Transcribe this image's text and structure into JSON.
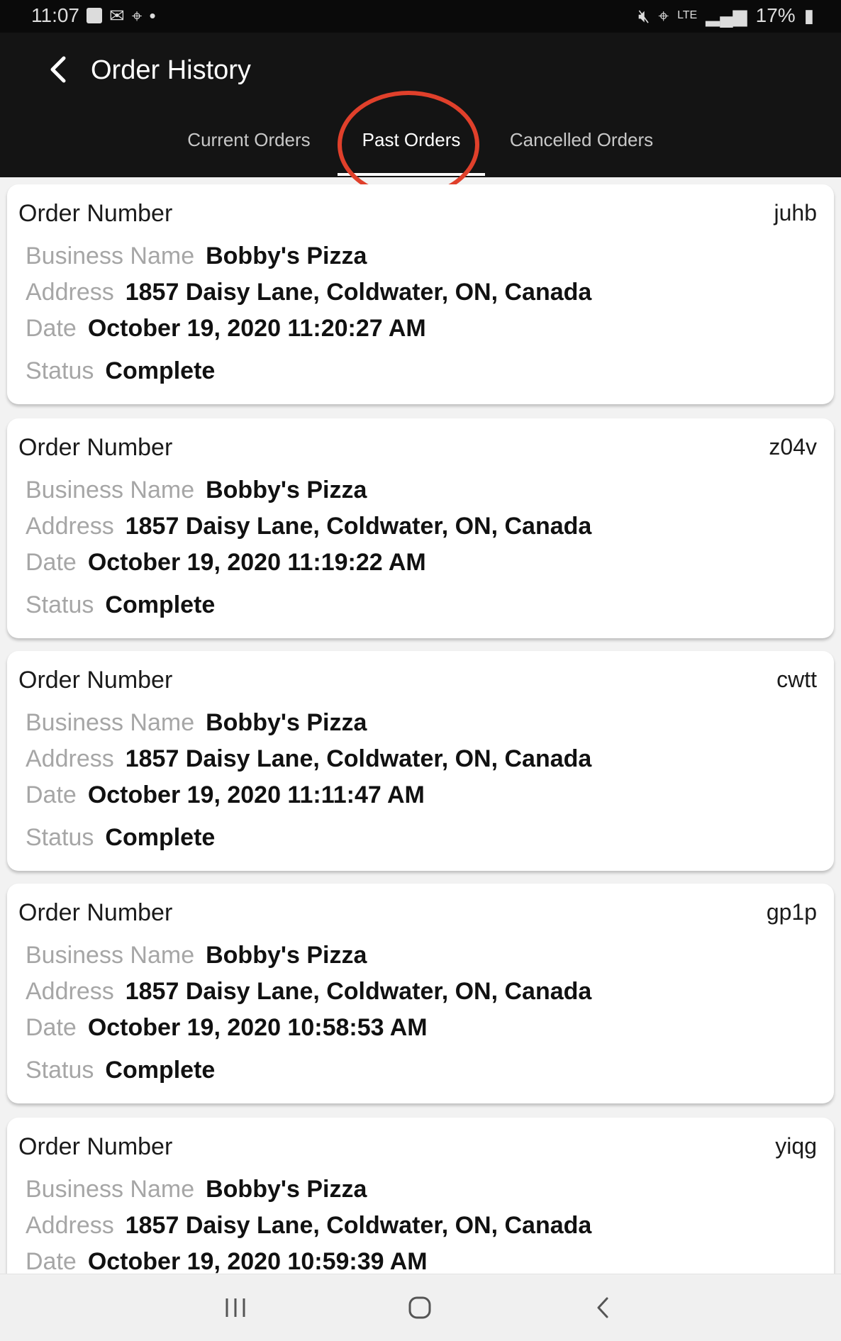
{
  "status_bar": {
    "time": "11:07",
    "battery": "17%",
    "icons_left": [
      "gallery-icon",
      "mail-icon",
      "location-icon",
      "dot-icon"
    ],
    "icons_right": [
      "mute-icon",
      "location-icon",
      "lte-icon",
      "signal-icon",
      "battery-icon"
    ]
  },
  "header": {
    "title": "Order History",
    "back_icon": "chevron-left-icon"
  },
  "tabs": [
    {
      "label": "Current Orders",
      "active": false
    },
    {
      "label": "Past Orders",
      "active": true
    },
    {
      "label": "Cancelled Orders",
      "active": false
    }
  ],
  "annotation_color": "#e0402b",
  "orders": [
    {
      "order_label": "Order Number",
      "order_id": "juhb",
      "business_label": "Business Name",
      "business_name": "Bobby's Pizza",
      "address_label": "Address",
      "address": "1857 Daisy Lane, Coldwater, ON, Canada",
      "date_label": "Date",
      "date": "October 19, 2020 11:20:27 AM",
      "status_label": "Status",
      "status": "Complete"
    },
    {
      "order_label": "Order Number",
      "order_id": "z04v",
      "business_label": "Business Name",
      "business_name": "Bobby's Pizza",
      "address_label": "Address",
      "address": "1857 Daisy Lane, Coldwater, ON, Canada",
      "date_label": "Date",
      "date": "October 19, 2020 11:19:22 AM",
      "status_label": "Status",
      "status": "Complete"
    },
    {
      "order_label": "Order Number",
      "order_id": "cwtt",
      "business_label": "Business Name",
      "business_name": "Bobby's Pizza",
      "address_label": "Address",
      "address": "1857 Daisy Lane, Coldwater, ON, Canada",
      "date_label": "Date",
      "date": "October 19, 2020 11:11:47 AM",
      "status_label": "Status",
      "status": "Complete"
    },
    {
      "order_label": "Order Number",
      "order_id": "gp1p",
      "business_label": "Business Name",
      "business_name": "Bobby's Pizza",
      "address_label": "Address",
      "address": "1857 Daisy Lane, Coldwater, ON, Canada",
      "date_label": "Date",
      "date": "October 19, 2020 10:58:53 AM",
      "status_label": "Status",
      "status": "Complete"
    },
    {
      "order_label": "Order Number",
      "order_id": "yiqg",
      "business_label": "Business Name",
      "business_name": "Bobby's Pizza",
      "address_label": "Address",
      "address": "1857 Daisy Lane, Coldwater, ON, Canada",
      "date_label": "Date",
      "date": "October 19, 2020 10:59:39 AM"
    }
  ],
  "nav_bar": {
    "buttons": [
      "recents-icon",
      "home-icon",
      "back-icon"
    ]
  }
}
